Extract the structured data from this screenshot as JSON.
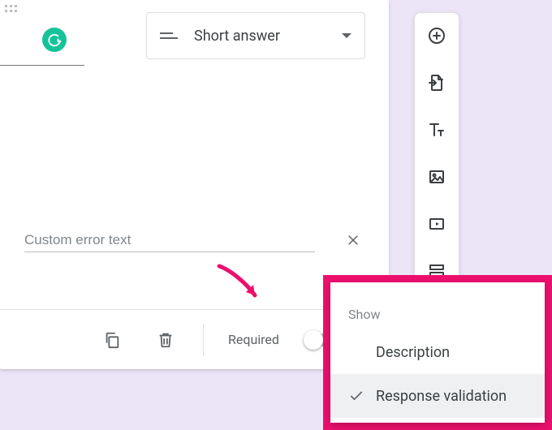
{
  "question_type": {
    "label": "Short answer"
  },
  "error_input": {
    "placeholder": "Custom error text",
    "value": ""
  },
  "footer": {
    "required_label": "Required"
  },
  "popup": {
    "header": "Show",
    "items": [
      {
        "label": "Description"
      },
      {
        "label": "Response validation"
      }
    ]
  },
  "colors": {
    "highlight": "#ec0f6e",
    "page_bg": "#ece4f7"
  }
}
